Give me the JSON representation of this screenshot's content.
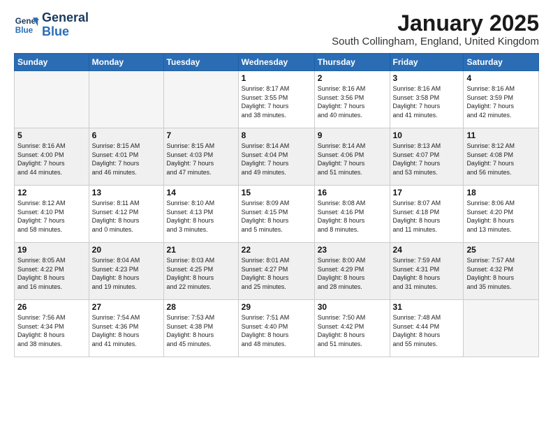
{
  "logo": {
    "line1": "General",
    "line2": "Blue"
  },
  "title": "January 2025",
  "location": "South Collingham, England, United Kingdom",
  "weekdays": [
    "Sunday",
    "Monday",
    "Tuesday",
    "Wednesday",
    "Thursday",
    "Friday",
    "Saturday"
  ],
  "weeks": [
    [
      {
        "day": "",
        "text": ""
      },
      {
        "day": "",
        "text": ""
      },
      {
        "day": "",
        "text": ""
      },
      {
        "day": "1",
        "text": "Sunrise: 8:17 AM\nSunset: 3:55 PM\nDaylight: 7 hours\nand 38 minutes."
      },
      {
        "day": "2",
        "text": "Sunrise: 8:16 AM\nSunset: 3:56 PM\nDaylight: 7 hours\nand 40 minutes."
      },
      {
        "day": "3",
        "text": "Sunrise: 8:16 AM\nSunset: 3:58 PM\nDaylight: 7 hours\nand 41 minutes."
      },
      {
        "day": "4",
        "text": "Sunrise: 8:16 AM\nSunset: 3:59 PM\nDaylight: 7 hours\nand 42 minutes."
      }
    ],
    [
      {
        "day": "5",
        "text": "Sunrise: 8:16 AM\nSunset: 4:00 PM\nDaylight: 7 hours\nand 44 minutes."
      },
      {
        "day": "6",
        "text": "Sunrise: 8:15 AM\nSunset: 4:01 PM\nDaylight: 7 hours\nand 46 minutes."
      },
      {
        "day": "7",
        "text": "Sunrise: 8:15 AM\nSunset: 4:03 PM\nDaylight: 7 hours\nand 47 minutes."
      },
      {
        "day": "8",
        "text": "Sunrise: 8:14 AM\nSunset: 4:04 PM\nDaylight: 7 hours\nand 49 minutes."
      },
      {
        "day": "9",
        "text": "Sunrise: 8:14 AM\nSunset: 4:06 PM\nDaylight: 7 hours\nand 51 minutes."
      },
      {
        "day": "10",
        "text": "Sunrise: 8:13 AM\nSunset: 4:07 PM\nDaylight: 7 hours\nand 53 minutes."
      },
      {
        "day": "11",
        "text": "Sunrise: 8:12 AM\nSunset: 4:08 PM\nDaylight: 7 hours\nand 56 minutes."
      }
    ],
    [
      {
        "day": "12",
        "text": "Sunrise: 8:12 AM\nSunset: 4:10 PM\nDaylight: 7 hours\nand 58 minutes."
      },
      {
        "day": "13",
        "text": "Sunrise: 8:11 AM\nSunset: 4:12 PM\nDaylight: 8 hours\nand 0 minutes."
      },
      {
        "day": "14",
        "text": "Sunrise: 8:10 AM\nSunset: 4:13 PM\nDaylight: 8 hours\nand 3 minutes."
      },
      {
        "day": "15",
        "text": "Sunrise: 8:09 AM\nSunset: 4:15 PM\nDaylight: 8 hours\nand 5 minutes."
      },
      {
        "day": "16",
        "text": "Sunrise: 8:08 AM\nSunset: 4:16 PM\nDaylight: 8 hours\nand 8 minutes."
      },
      {
        "day": "17",
        "text": "Sunrise: 8:07 AM\nSunset: 4:18 PM\nDaylight: 8 hours\nand 11 minutes."
      },
      {
        "day": "18",
        "text": "Sunrise: 8:06 AM\nSunset: 4:20 PM\nDaylight: 8 hours\nand 13 minutes."
      }
    ],
    [
      {
        "day": "19",
        "text": "Sunrise: 8:05 AM\nSunset: 4:22 PM\nDaylight: 8 hours\nand 16 minutes."
      },
      {
        "day": "20",
        "text": "Sunrise: 8:04 AM\nSunset: 4:23 PM\nDaylight: 8 hours\nand 19 minutes."
      },
      {
        "day": "21",
        "text": "Sunrise: 8:03 AM\nSunset: 4:25 PM\nDaylight: 8 hours\nand 22 minutes."
      },
      {
        "day": "22",
        "text": "Sunrise: 8:01 AM\nSunset: 4:27 PM\nDaylight: 8 hours\nand 25 minutes."
      },
      {
        "day": "23",
        "text": "Sunrise: 8:00 AM\nSunset: 4:29 PM\nDaylight: 8 hours\nand 28 minutes."
      },
      {
        "day": "24",
        "text": "Sunrise: 7:59 AM\nSunset: 4:31 PM\nDaylight: 8 hours\nand 31 minutes."
      },
      {
        "day": "25",
        "text": "Sunrise: 7:57 AM\nSunset: 4:32 PM\nDaylight: 8 hours\nand 35 minutes."
      }
    ],
    [
      {
        "day": "26",
        "text": "Sunrise: 7:56 AM\nSunset: 4:34 PM\nDaylight: 8 hours\nand 38 minutes."
      },
      {
        "day": "27",
        "text": "Sunrise: 7:54 AM\nSunset: 4:36 PM\nDaylight: 8 hours\nand 41 minutes."
      },
      {
        "day": "28",
        "text": "Sunrise: 7:53 AM\nSunset: 4:38 PM\nDaylight: 8 hours\nand 45 minutes."
      },
      {
        "day": "29",
        "text": "Sunrise: 7:51 AM\nSunset: 4:40 PM\nDaylight: 8 hours\nand 48 minutes."
      },
      {
        "day": "30",
        "text": "Sunrise: 7:50 AM\nSunset: 4:42 PM\nDaylight: 8 hours\nand 51 minutes."
      },
      {
        "day": "31",
        "text": "Sunrise: 7:48 AM\nSunset: 4:44 PM\nDaylight: 8 hours\nand 55 minutes."
      },
      {
        "day": "",
        "text": ""
      }
    ]
  ]
}
